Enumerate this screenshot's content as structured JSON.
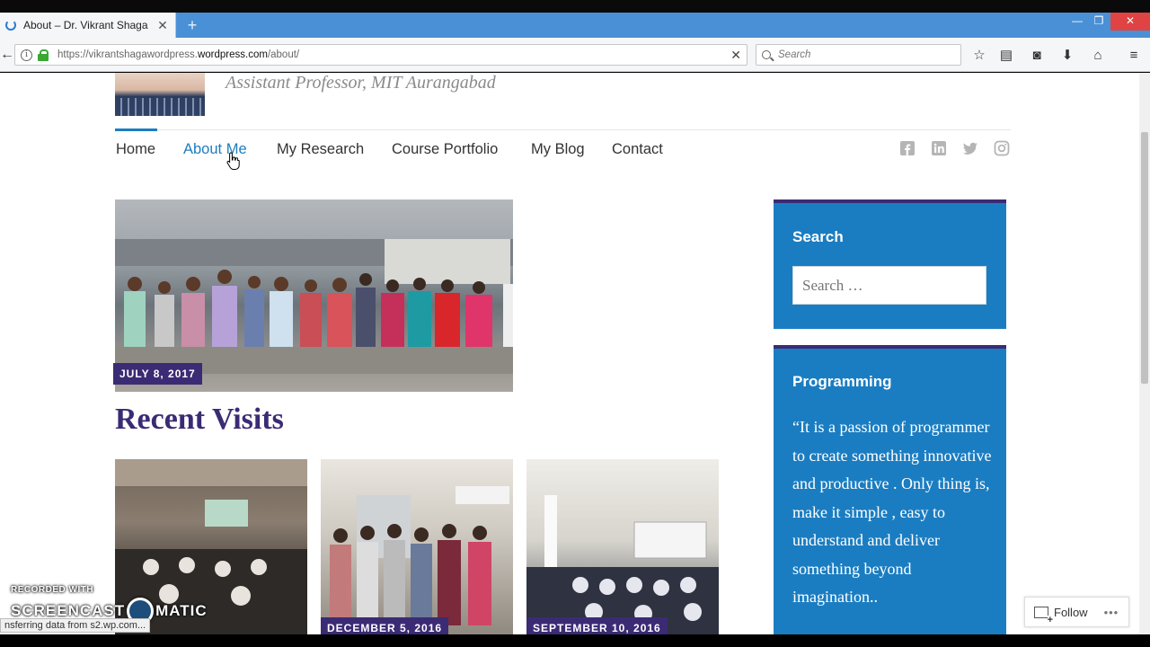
{
  "browser": {
    "tab_title": "About – Dr. Vikrant Shaga",
    "tab_close": "✕",
    "new_tab": "+",
    "url_prefix": "https://vikrantshagawordpress.",
    "url_domain": "wordpress.com",
    "url_suffix": "/about/",
    "search_placeholder": "Search"
  },
  "site": {
    "tagline": "Assistant Professor, MIT Aurangabad"
  },
  "nav": {
    "items": [
      {
        "label": "Home"
      },
      {
        "label": "About Me"
      },
      {
        "label": "My Research"
      },
      {
        "label": "Course Portfolio"
      },
      {
        "label": "My Blog"
      },
      {
        "label": "Contact"
      }
    ]
  },
  "content": {
    "feature_date": "JULY 8, 2017",
    "section_title": "Recent Visits",
    "thumbs": [
      {
        "date": ""
      },
      {
        "date": "DECEMBER 5, 2016"
      },
      {
        "date": "SEPTEMBER 10, 2016"
      }
    ]
  },
  "sidebar": {
    "search_title": "Search",
    "search_placeholder": "Search …",
    "programming_title": "Programming",
    "programming_quote": "“It is a passion of programmer to create something innovative and productive . Only thing is, make it simple , easy to understand and deliver something  beyond imagination.."
  },
  "follow": {
    "label": "Follow",
    "more": "•••"
  },
  "watermark": {
    "line1": "RECORDED WITH",
    "line2a": "SCREENCAST",
    "line2b": "MATIC"
  },
  "status_text": "nsferring data from s2.wp.com...",
  "colors": {
    "accent_blue": "#1d7dbf",
    "brand_purple": "#3b2b74",
    "widget_blue": "#1b7dc1"
  }
}
